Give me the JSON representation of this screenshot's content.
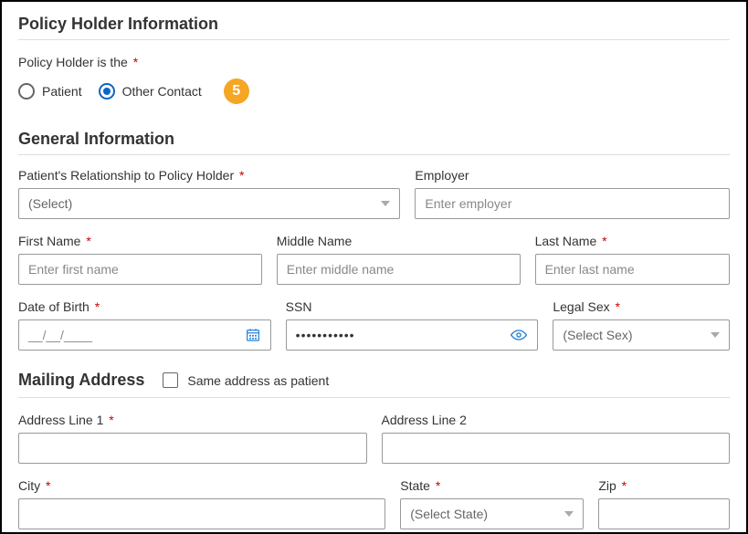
{
  "sections": {
    "policy_holder_info": "Policy Holder Information",
    "general_info": "General Information",
    "mailing_address": "Mailing Address"
  },
  "policy_holder_is_the": {
    "label": "Policy Holder is the",
    "options": {
      "patient": "Patient",
      "other_contact": "Other Contact"
    },
    "selected": "other_contact",
    "step_badge": "5"
  },
  "general": {
    "relationship": {
      "label": "Patient's Relationship to Policy Holder",
      "placeholder": "(Select)"
    },
    "employer": {
      "label": "Employer",
      "placeholder": "Enter employer"
    },
    "first_name": {
      "label": "First Name",
      "placeholder": "Enter first name"
    },
    "middle_name": {
      "label": "Middle Name",
      "placeholder": "Enter middle name"
    },
    "last_name": {
      "label": "Last Name",
      "placeholder": "Enter last name"
    },
    "dob": {
      "label": "Date of Birth",
      "mask": "__/__/____"
    },
    "ssn": {
      "label": "SSN",
      "masked_value": "•••••••••••"
    },
    "legal_sex": {
      "label": "Legal Sex",
      "placeholder": "(Select Sex)"
    }
  },
  "mailing": {
    "same_as_patient": "Same address as patient",
    "address1": {
      "label": "Address Line 1"
    },
    "address2": {
      "label": "Address Line 2"
    },
    "city": {
      "label": "City"
    },
    "state": {
      "label": "State",
      "placeholder": "(Select State)"
    },
    "zip": {
      "label": "Zip"
    }
  }
}
